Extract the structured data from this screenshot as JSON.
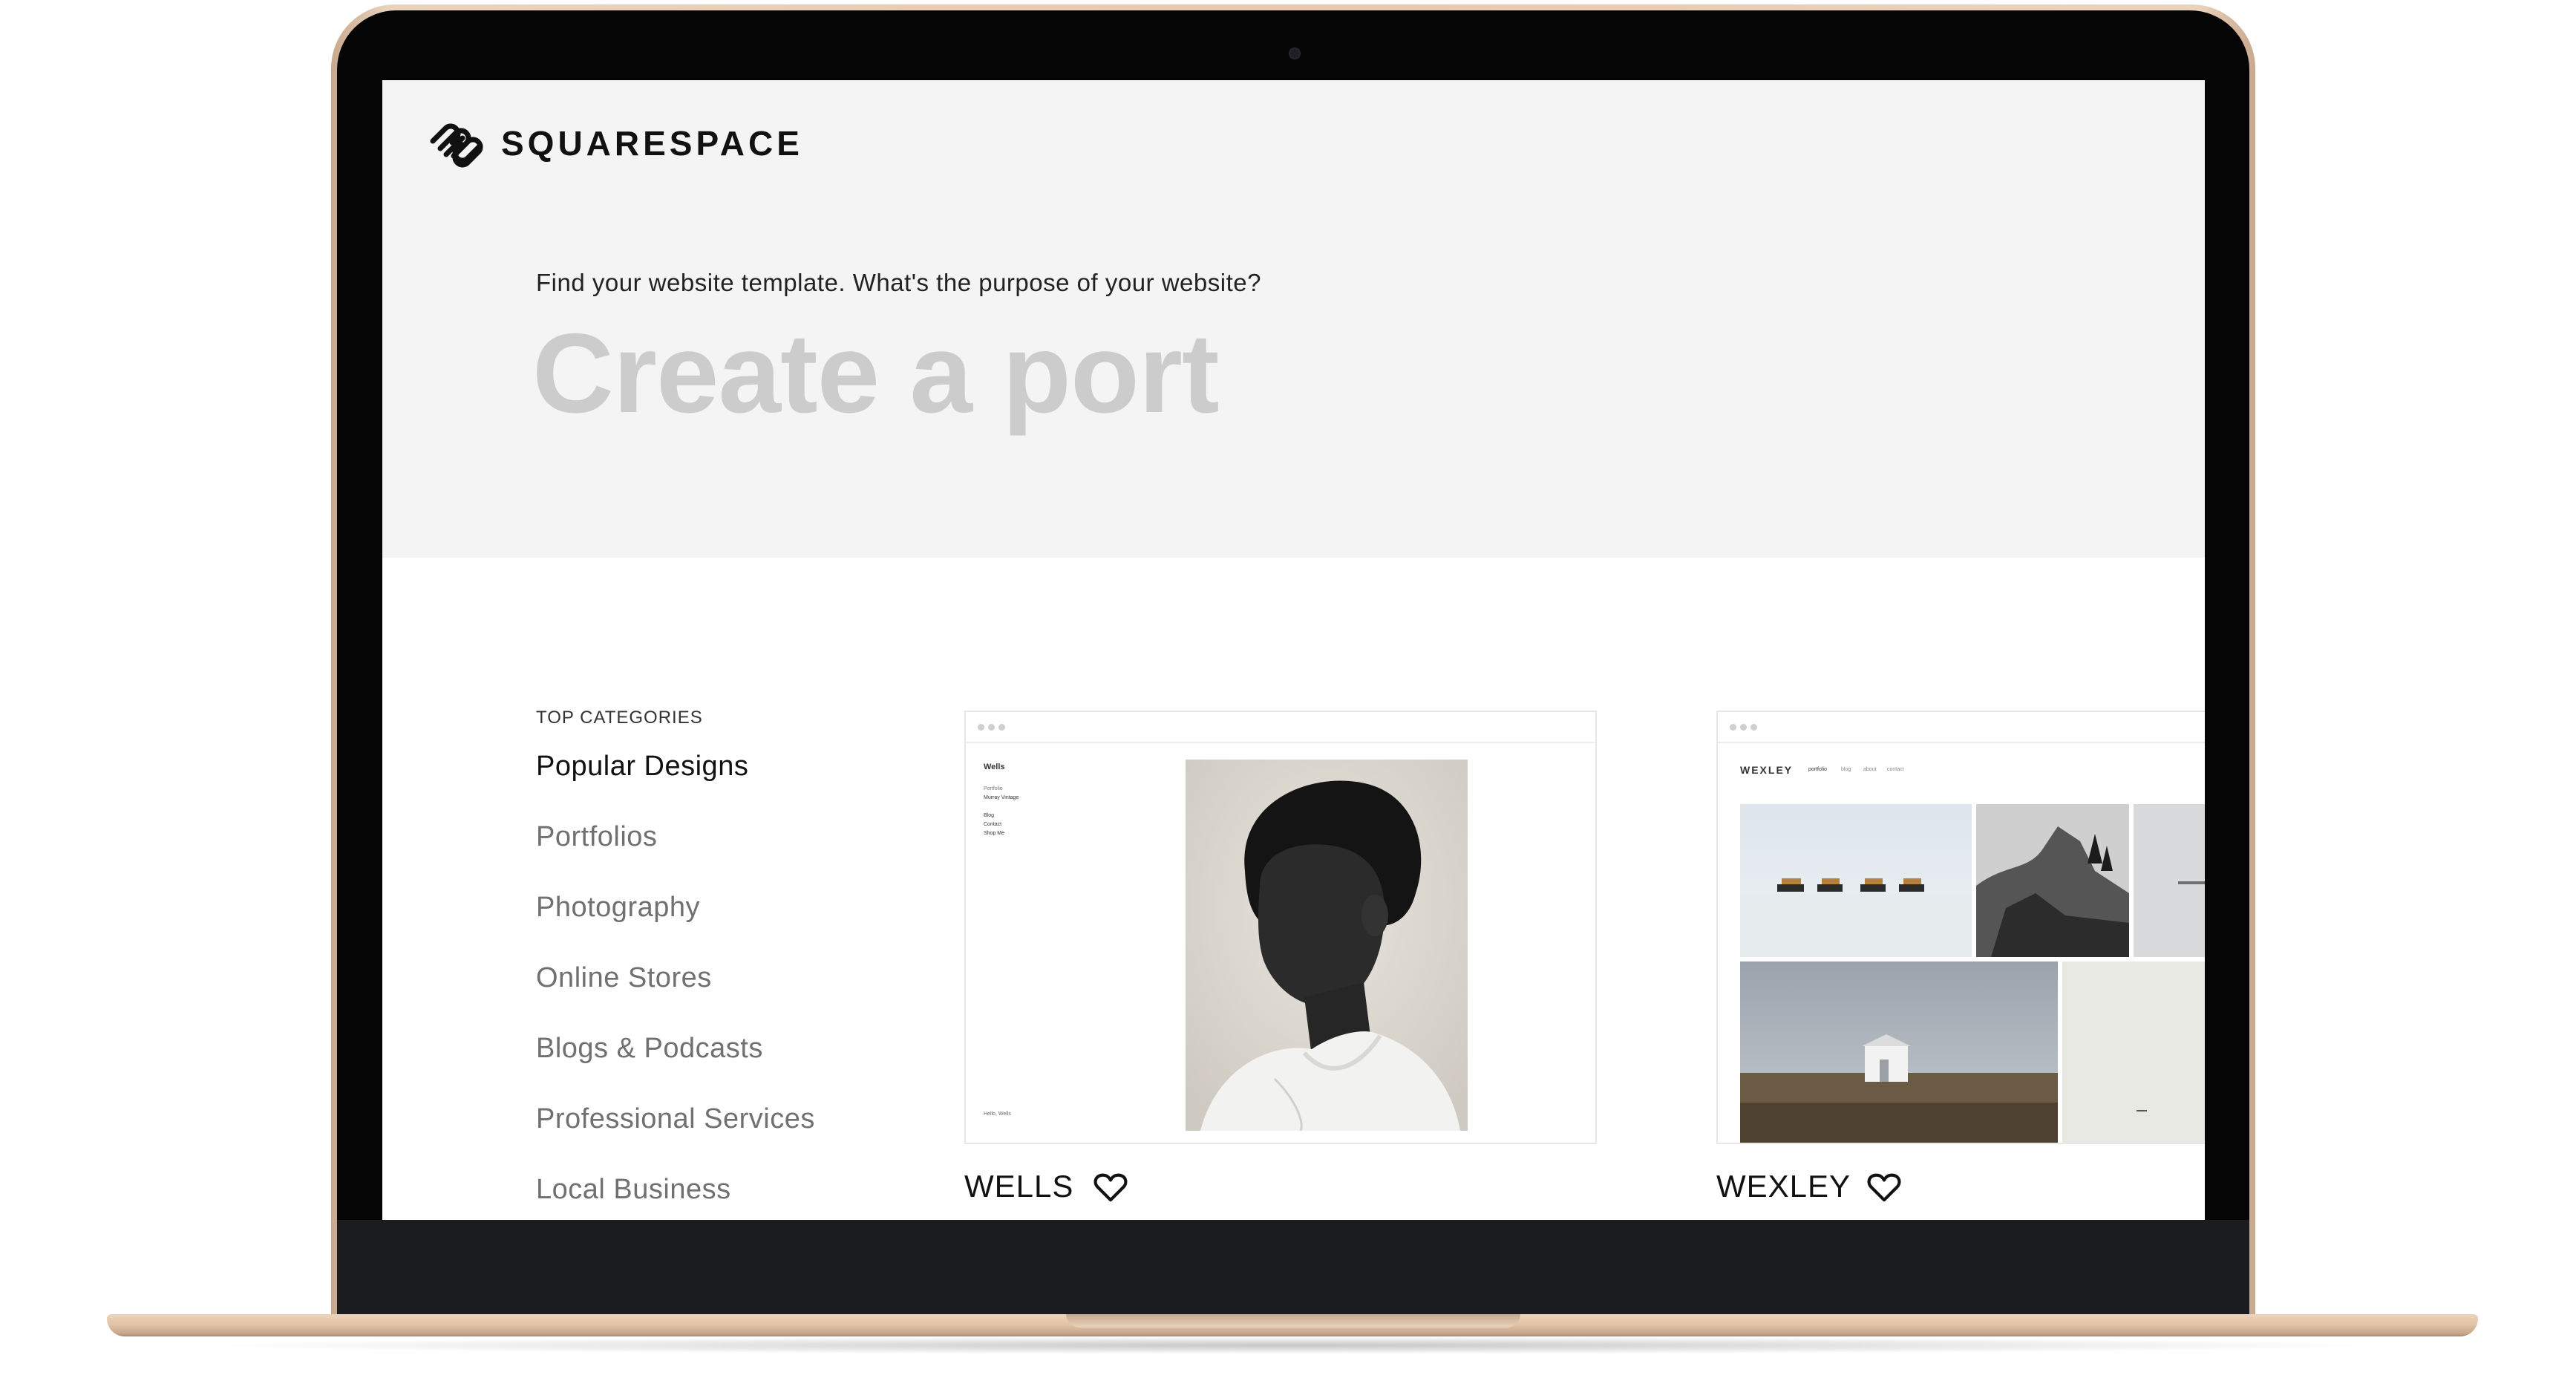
{
  "brand": {
    "name": "SQUARESPACE"
  },
  "hero": {
    "prompt": "Find your website template. What's the purpose of your website?",
    "query_text": "Create a port"
  },
  "categories": {
    "heading": "TOP CATEGORIES",
    "items": [
      {
        "label": "Popular Designs",
        "active": true
      },
      {
        "label": "Portfolios"
      },
      {
        "label": "Photography"
      },
      {
        "label": "Online Stores"
      },
      {
        "label": "Blogs & Podcasts"
      },
      {
        "label": "Professional Services"
      },
      {
        "label": "Local Business"
      }
    ]
  },
  "templates": [
    {
      "name": "WELLS",
      "preview": {
        "site_title": "Wells",
        "nav": [
          "Portfolio",
          "Murray Vintage",
          "Blog",
          "Contact",
          "Shop Me"
        ],
        "footer": "Hello, Wells"
      },
      "favorite_icon": "heart-icon"
    },
    {
      "name": "WEXLEY",
      "preview": {
        "site_title": "WEXLEY",
        "nav": [
          "portfolio",
          "blog",
          "about",
          "contact"
        ]
      },
      "favorite_icon": "heart-icon"
    }
  ],
  "colors": {
    "hero_bg": "#f4f4f4",
    "placeholder_text": "#cccccc",
    "laptop_gold": "#e6c9ae"
  }
}
